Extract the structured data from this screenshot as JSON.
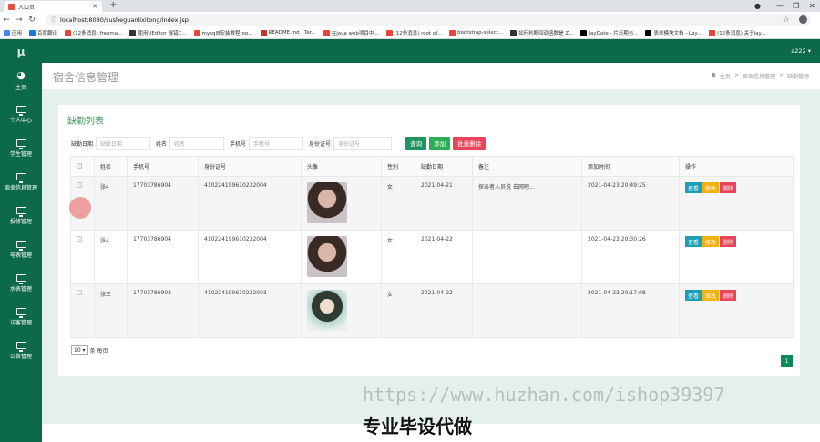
{
  "browser": {
    "tab_title": "入口页",
    "url": "localhost:8080/susheguanlixitong/index.jsp",
    "bookmarks": [
      "应用",
      "百度翻译",
      "(12条消息) freema...",
      "使用UEditor 报错C...",
      "mysql8安装教程roo...",
      "README.md · Ter...",
      "在java web项目中...",
      "(12条消息) root of...",
      "bootstrap-select...",
      "如何判断回调函数是 Z...",
      "layDate - 片日期与...",
      "表单模块文档 - Lay...",
      "(12条消息) 关于lay..."
    ]
  },
  "sidebar": {
    "logo": "μ",
    "items": [
      {
        "label": "主页",
        "icon": "dashboard-icon"
      },
      {
        "label": "个人中心",
        "icon": "monitor-icon"
      },
      {
        "label": "学生管理",
        "icon": "monitor-icon"
      },
      {
        "label": "宿舍信息管理",
        "icon": "monitor-icon"
      },
      {
        "label": "报修管理",
        "icon": "monitor-icon"
      },
      {
        "label": "电表管理",
        "icon": "monitor-icon"
      },
      {
        "label": "水表管理",
        "icon": "monitor-icon"
      },
      {
        "label": "访客管理",
        "icon": "monitor-icon"
      },
      {
        "label": "公告管理",
        "icon": "monitor-icon"
      }
    ]
  },
  "topbar": {
    "user": "a222 ▾"
  },
  "pagehead": {
    "title": "宿舍信息管理",
    "breadcrumb": [
      "主页",
      ">",
      "宿舍信息管理",
      ">",
      "缺勤管理"
    ]
  },
  "card": {
    "title": "缺勤列表",
    "search": {
      "date_label": "缺勤日期",
      "date_placeholder": "缺勤日期",
      "name_label": "姓名",
      "name_placeholder": "姓名",
      "phone_label": "手机号",
      "phone_placeholder": "手机号",
      "id_label": "身份证号",
      "id_placeholder": "身份证号",
      "query": "查询",
      "add": "添加",
      "batch_delete": "批量删除"
    },
    "columns": [
      "",
      "姓名",
      "手机号",
      "身份证号",
      "头像",
      "性别",
      "缺勤日期",
      "备注",
      "添加时间",
      "操作"
    ],
    "rows": [
      {
        "name": "张4",
        "phone": "17703786904",
        "idno": "410224199610232004",
        "gender": "女",
        "date": "2021-04-21",
        "note": "探亲者人员说 去网吧...",
        "added": "2021-04-23 20:49:25"
      },
      {
        "name": "张4",
        "phone": "17703786904",
        "idno": "410224199610232004",
        "gender": "女",
        "date": "2021-04-22",
        "note": "",
        "added": "2021-04-23 20:30:26"
      },
      {
        "name": "张三",
        "phone": "17703786903",
        "idno": "410224199610232003",
        "gender": "女",
        "date": "2021-04-22",
        "note": "",
        "added": "2021-04-23 20:17:08"
      }
    ],
    "ops": {
      "view": "查看",
      "edit": "修改",
      "delete": "删除"
    },
    "page_size": "10 ▾",
    "page_size_suffix": "条 每页",
    "page": "1"
  },
  "overlay": {
    "watermark": "https://www.huzhan.com/ishop39397",
    "caption": "专业毕设代做"
  }
}
